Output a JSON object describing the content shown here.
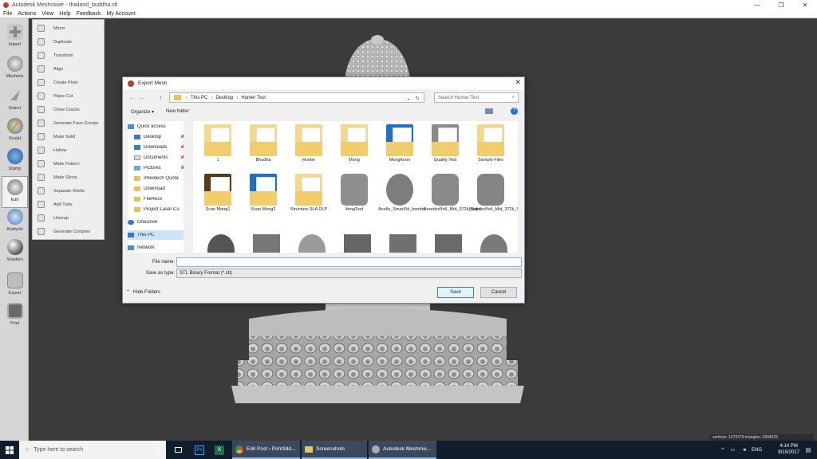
{
  "window": {
    "title": "Autodesk Meshmixer - thailand_buddha.stl",
    "controls": [
      "—",
      "❐",
      "✕"
    ]
  },
  "menu": [
    "File",
    "Actions",
    "View",
    "Help",
    "Feedback",
    "My Account"
  ],
  "toolbar": [
    {
      "label": "Import",
      "icon": "import-icon"
    },
    {
      "label": "Meshmix",
      "icon": "meshmix-icon"
    },
    {
      "label": "Select",
      "icon": "select-icon"
    },
    {
      "label": "Sculpt",
      "icon": "sculpt-icon"
    },
    {
      "label": "Stamp",
      "icon": "stamp-icon"
    },
    {
      "label": "Edit",
      "icon": "edit-icon"
    },
    {
      "label": "Analysis",
      "icon": "analysis-icon"
    },
    {
      "label": "Shaders",
      "icon": "shaders-icon"
    },
    {
      "label": "Export",
      "icon": "export-icon"
    },
    {
      "label": "Print",
      "icon": "print-icon"
    }
  ],
  "edit_menu": [
    "Mirror",
    "Duplicate",
    "Transform",
    "Align",
    "Create Pivot",
    "Plane Cut",
    "Close Cracks",
    "Generate Face Groups",
    "Make Solid",
    "Hollow",
    "Make Pattern",
    "Make Slices",
    "Separate Shells",
    "Add Tube",
    "Unwrap",
    "Generate Complex"
  ],
  "dialog": {
    "title": "Export Mesh",
    "close": "✕",
    "nav": {
      "back": "←",
      "forward": "→",
      "up": "↑",
      "refresh": "↻"
    },
    "breadcrumb": [
      "This PC",
      "Desktop",
      "Hunter Test"
    ],
    "search_placeholder": "Search Hunter Test",
    "organize": "Organize ▾",
    "new_folder": "New folder",
    "nav_pane": [
      {
        "label": "Quick access",
        "pin": ""
      },
      {
        "label": "Desktop",
        "pin": "📌"
      },
      {
        "label": "Downloads",
        "pin": "📌"
      },
      {
        "label": "Documents",
        "pin": "📌"
      },
      {
        "label": "Pictures",
        "pin": "📌"
      },
      {
        "label": "#Neotech Quota",
        "pin": ""
      },
      {
        "label": "Download",
        "pin": ""
      },
      {
        "label": "FileRecv",
        "pin": ""
      },
      {
        "label": "Project Laser Cu",
        "pin": ""
      },
      {
        "label": "OneDrive",
        "pin": ""
      },
      {
        "label": "This PC",
        "pin": ""
      },
      {
        "label": "Network",
        "pin": ""
      }
    ],
    "files": [
      {
        "name": "1",
        "kind": "folder"
      },
      {
        "name": "Bhudha",
        "kind": "folder"
      },
      {
        "name": "Hunter",
        "kind": "folder"
      },
      {
        "name": "Mong",
        "kind": "folder"
      },
      {
        "name": "MongKoon",
        "kind": "folder-blue"
      },
      {
        "name": "Quality Test",
        "kind": "folder-gray"
      },
      {
        "name": "Sample Files",
        "kind": "folder"
      },
      {
        "name": "Scan Mong1",
        "kind": "folder-photo"
      },
      {
        "name": "Scan Mong2",
        "kind": "folder-blue"
      },
      {
        "name": "Structure SLA DLP",
        "kind": "folder-doc"
      },
      {
        "name": "4ringTest",
        "kind": "mesh"
      },
      {
        "name": "Anello_Smart3d_bambo",
        "kind": "mesh"
      },
      {
        "name": "BeardedYell_Mid_372k_Solid",
        "kind": "mesh"
      },
      {
        "name": "BeardedYell_Mid_372k_Solid_support",
        "kind": "mesh"
      },
      {
        "name": "",
        "kind": "mesh"
      },
      {
        "name": "",
        "kind": "mesh"
      },
      {
        "name": "",
        "kind": "mesh"
      },
      {
        "name": "",
        "kind": "mesh"
      },
      {
        "name": "",
        "kind": "mesh"
      },
      {
        "name": "",
        "kind": "mesh"
      },
      {
        "name": "",
        "kind": "mesh"
      }
    ],
    "file_name_label": "File name:",
    "file_name_value": "",
    "save_type_label": "Save as type:",
    "save_type_value": "STL Binary Format (*.stl)",
    "hide_folders": "Hide Folders",
    "save": "Save",
    "cancel": "Cancel"
  },
  "status": "vertices: 1472379 triangles: 2944629",
  "taskbar": {
    "search_placeholder": "Type here to search",
    "apps": [
      {
        "label": "",
        "icon": "mic-icon"
      },
      {
        "label": "",
        "icon": "task-view-icon"
      },
      {
        "label": "",
        "icon": "photoshop-icon"
      },
      {
        "label": "",
        "icon": "excel-icon"
      },
      {
        "label": "Edit Post ‹ Print3dd...",
        "icon": "chrome-icon"
      },
      {
        "label": "Screenshots",
        "icon": "folder-icon"
      },
      {
        "label": "Autodesk Meshmix...",
        "icon": "meshmixer-icon"
      }
    ],
    "lang": "ENG",
    "time": "4:14 PM",
    "date": "9/15/2017"
  },
  "colors": {
    "accent": "#0078d7",
    "viewport": "#3b3b3b",
    "taskbar": "#0f1d2c",
    "folder": "#f4d98a",
    "mesh": "#9a9a9a"
  }
}
